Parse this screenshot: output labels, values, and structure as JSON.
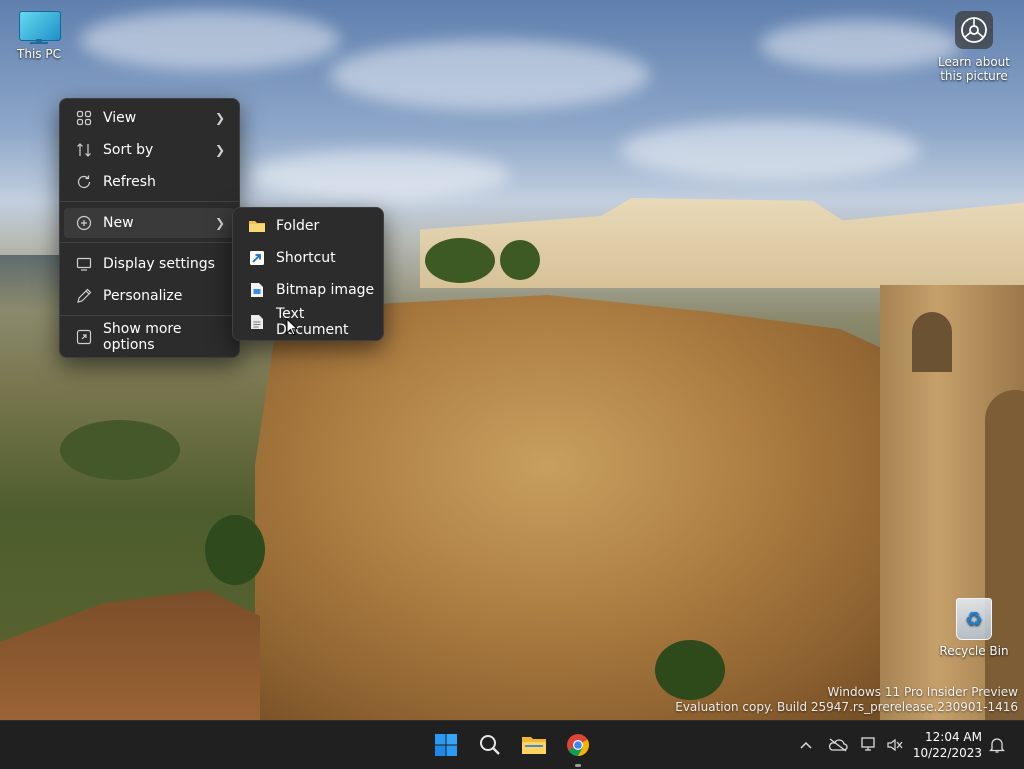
{
  "desktop": {
    "icons": {
      "this_pc": {
        "label": "This PC",
        "icon": "this-pc-icon"
      },
      "learn": {
        "label_line1": "Learn about",
        "label_line2": "this picture",
        "icon": "camera-icon"
      },
      "recycle_bin": {
        "label": "Recycle Bin",
        "icon": "recycle-bin-icon"
      }
    },
    "watermark": {
      "line1": "Windows 11 Pro Insider Preview",
      "line2": "Evaluation copy. Build 25947.rs_prerelease.230901-1416"
    }
  },
  "context_menu": {
    "items": [
      {
        "label": "View",
        "icon": "view-grid-icon",
        "submenu": true
      },
      {
        "label": "Sort by",
        "icon": "sort-icon",
        "submenu": true
      },
      {
        "label": "Refresh",
        "icon": "refresh-icon",
        "submenu": false
      },
      {
        "label": "New",
        "icon": "new-plus-icon",
        "submenu": true,
        "active": true
      },
      {
        "label": "Display settings",
        "icon": "display-icon",
        "submenu": false
      },
      {
        "label": "Personalize",
        "icon": "pen-icon",
        "submenu": false
      },
      {
        "label": "Show more options",
        "icon": "more-options-icon",
        "submenu": false
      }
    ]
  },
  "new_submenu": {
    "items": [
      {
        "label": "Folder",
        "icon": "folder-icon"
      },
      {
        "label": "Shortcut",
        "icon": "shortcut-icon"
      },
      {
        "label": "Bitmap image",
        "icon": "bitmap-icon"
      },
      {
        "label": "Text Document",
        "icon": "text-document-icon"
      }
    ]
  },
  "taskbar": {
    "apps": [
      {
        "name": "Start",
        "icon": "windows-start-icon"
      },
      {
        "name": "Search",
        "icon": "search-icon"
      },
      {
        "name": "File Explorer",
        "icon": "file-explorer-icon"
      },
      {
        "name": "Google Chrome",
        "icon": "chrome-icon",
        "running": true
      }
    ],
    "tray_icons": [
      "chevron-up-icon",
      "onedrive-offline-icon",
      "network-icon",
      "volume-muted-icon"
    ],
    "clock": {
      "time": "12:04 AM",
      "date": "10/22/2023"
    },
    "notification_icon": "bell-icon"
  },
  "colors": {
    "menu_bg": "#2c2c2c",
    "taskbar_bg": "#202020",
    "accent": "#0078d4"
  }
}
